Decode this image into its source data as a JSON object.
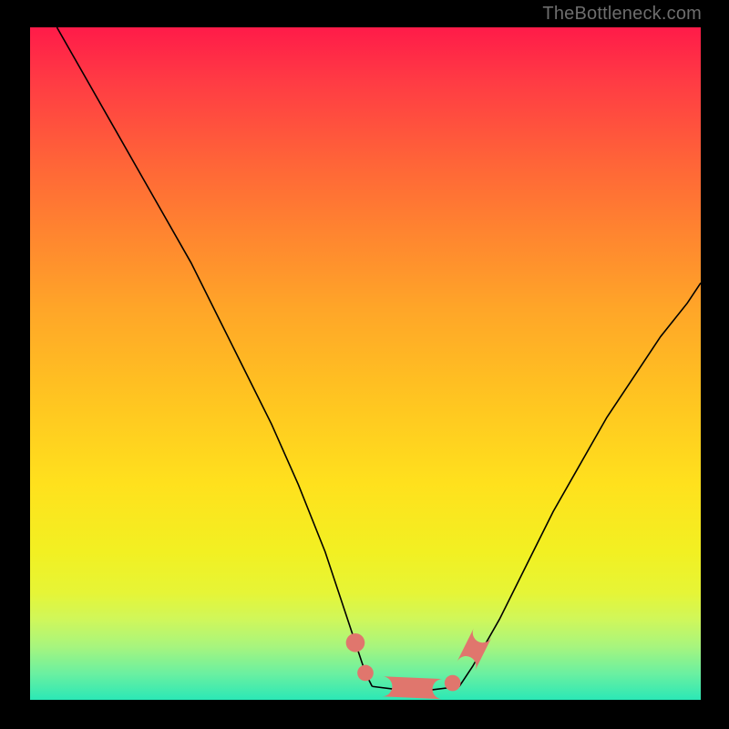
{
  "watermark": "TheBottleneck.com",
  "chart_data": {
    "type": "line",
    "title": "",
    "xlabel": "",
    "ylabel": "",
    "xlim": [
      0,
      100
    ],
    "ylim": [
      0,
      100
    ],
    "grid": false,
    "legend": false,
    "series": [
      {
        "name": "left-branch",
        "x": [
          4,
          8,
          12,
          16,
          20,
          24,
          28,
          32,
          36,
          40,
          44,
          46,
          48,
          50,
          51
        ],
        "y": [
          100,
          93,
          86,
          79,
          72,
          65,
          57,
          49,
          41,
          32,
          22,
          16,
          10,
          4,
          2
        ]
      },
      {
        "name": "floor",
        "x": [
          51,
          55,
          60,
          64
        ],
        "y": [
          2,
          1.5,
          1.5,
          2
        ]
      },
      {
        "name": "right-branch",
        "x": [
          64,
          66,
          70,
          74,
          78,
          82,
          86,
          90,
          94,
          98,
          100
        ],
        "y": [
          2,
          5,
          12,
          20,
          28,
          35,
          42,
          48,
          54,
          59,
          62
        ]
      }
    ],
    "markers": [
      {
        "shape": "dot",
        "x": 48.5,
        "y": 8.5,
        "r": 1.4
      },
      {
        "shape": "dot",
        "x": 50.0,
        "y": 4.0,
        "r": 1.2
      },
      {
        "shape": "pill",
        "x1": 52.5,
        "y1": 2.0,
        "x2": 61.5,
        "y2": 1.6,
        "r": 1.5
      },
      {
        "shape": "dot",
        "x": 63.0,
        "y": 2.5,
        "r": 1.2
      },
      {
        "shape": "pill",
        "x1": 65.0,
        "y1": 5.0,
        "x2": 67.5,
        "y2": 10.0,
        "r": 1.5
      }
    ],
    "background_gradient": {
      "type": "vertical",
      "stops": [
        {
          "pos": 0.0,
          "color": "#ff1b49"
        },
        {
          "pos": 0.3,
          "color": "#ff8330"
        },
        {
          "pos": 0.55,
          "color": "#ffc421"
        },
        {
          "pos": 0.78,
          "color": "#f2f022"
        },
        {
          "pos": 1.0,
          "color": "#2be8b6"
        }
      ]
    }
  }
}
